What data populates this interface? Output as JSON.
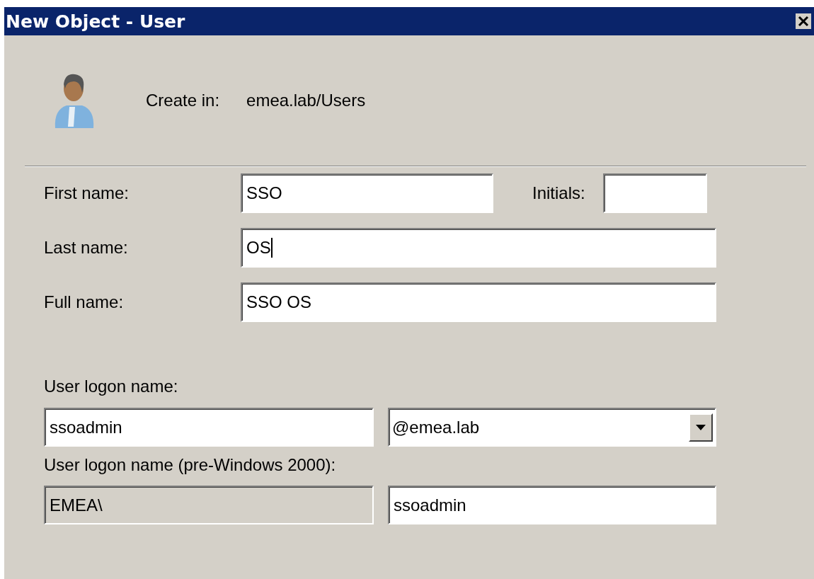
{
  "window": {
    "title": "New Object - User"
  },
  "create_in": {
    "label": "Create in:",
    "value": "emea.lab/Users"
  },
  "name_fields": [
    {
      "label": "First name:",
      "value": "SSO",
      "focused": false
    },
    {
      "label": "Initials:",
      "focused": false
    },
    {
      "label": "Last name:",
      "value": "OS",
      "focused": true
    },
    {
      "label": "Full name:",
      "value": "SSO OS",
      "focused": false
    }
  ],
  "logon": {
    "label": "User logon name:",
    "value": "ssoadmin",
    "domain": "@emea.lab"
  },
  "pre2000": {
    "label": "User logon name (pre-Windows 2000):",
    "prefix": "EMEA\\",
    "prefix_disabled": true,
    "value": "ssoadmin"
  }
}
